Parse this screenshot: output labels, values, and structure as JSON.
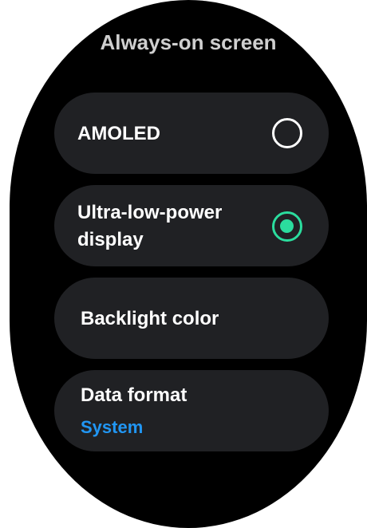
{
  "screen": {
    "title": "Always-on screen"
  },
  "options": [
    {
      "label": "AMOLED",
      "selected": false
    },
    {
      "label_line1": "Ultra-low-power",
      "label_line2": "display",
      "selected": true
    }
  ],
  "settings": {
    "backlight_color": {
      "label": "Backlight color"
    },
    "data_format": {
      "label": "Data format",
      "value": "System"
    }
  },
  "colors": {
    "background": "#000000",
    "card": "#202124",
    "accent_selected": "#2bdd9e",
    "link_value": "#2196f3"
  },
  "icons": {
    "amoled_radio": "radio-unselected-icon",
    "ultra_low_power_radio": "radio-selected-icon"
  }
}
